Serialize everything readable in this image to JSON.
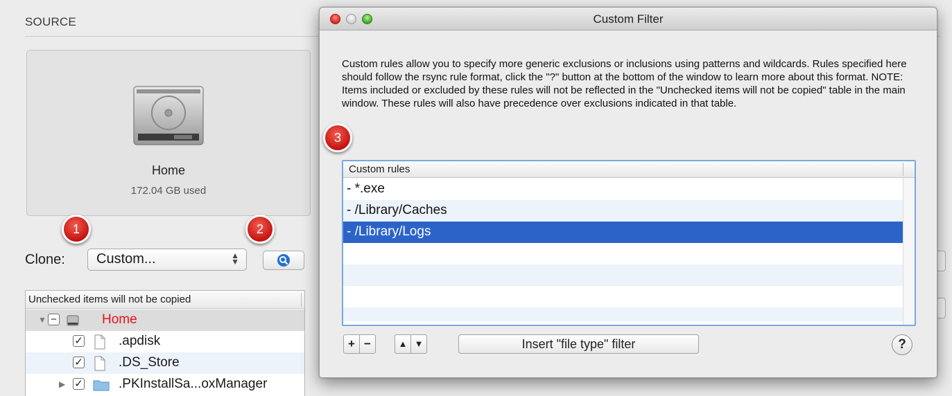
{
  "main": {
    "source_label": "SOURCE",
    "disk": {
      "name": "Home",
      "used": "172.04 GB used"
    },
    "clone": {
      "label": "Clone:",
      "value": "Custom..."
    },
    "unchecked_table": {
      "header": "Unchecked items will not be copied",
      "rows": [
        {
          "name": "Home",
          "checked": "mixed",
          "icon": "hard-drive-icon"
        },
        {
          "name": ".apdisk",
          "checked": "true",
          "icon": "document-icon"
        },
        {
          "name": ".DS_Store",
          "checked": "true",
          "icon": "document-icon"
        },
        {
          "name": ".PKInstallSa...oxManager",
          "checked": "true",
          "icon": "folder-icon"
        }
      ]
    }
  },
  "filter_window": {
    "title": "Custom Filter",
    "description": "Custom rules allow you to specify more generic exclusions or inclusions using patterns and wildcards. Rules specified here should follow the rsync rule format, click the \"?\" button at the bottom of the window to learn more about this format. NOTE: Items included or excluded by these rules will not be reflected in the \"Unchecked items will not be copied\" table in the main window. These rules will also have precedence over exclusions indicated in that table.",
    "rules_header": "Custom rules",
    "rules": [
      "- *.exe",
      "- /Library/Caches",
      "- /Library/Logs"
    ],
    "selected_rule_index": 2,
    "buttons": {
      "add": "+",
      "remove": "−",
      "move_up": "▲",
      "move_down": "▼",
      "insert_filter": "Insert \"file type\" filter",
      "help": "?"
    }
  },
  "callouts": [
    "1",
    "2",
    "3"
  ],
  "colors": {
    "selection": "#2c63c9",
    "callout": "#d01e18",
    "root_item_text": "#e3141b",
    "focus_ring": "#7aa7e3"
  }
}
